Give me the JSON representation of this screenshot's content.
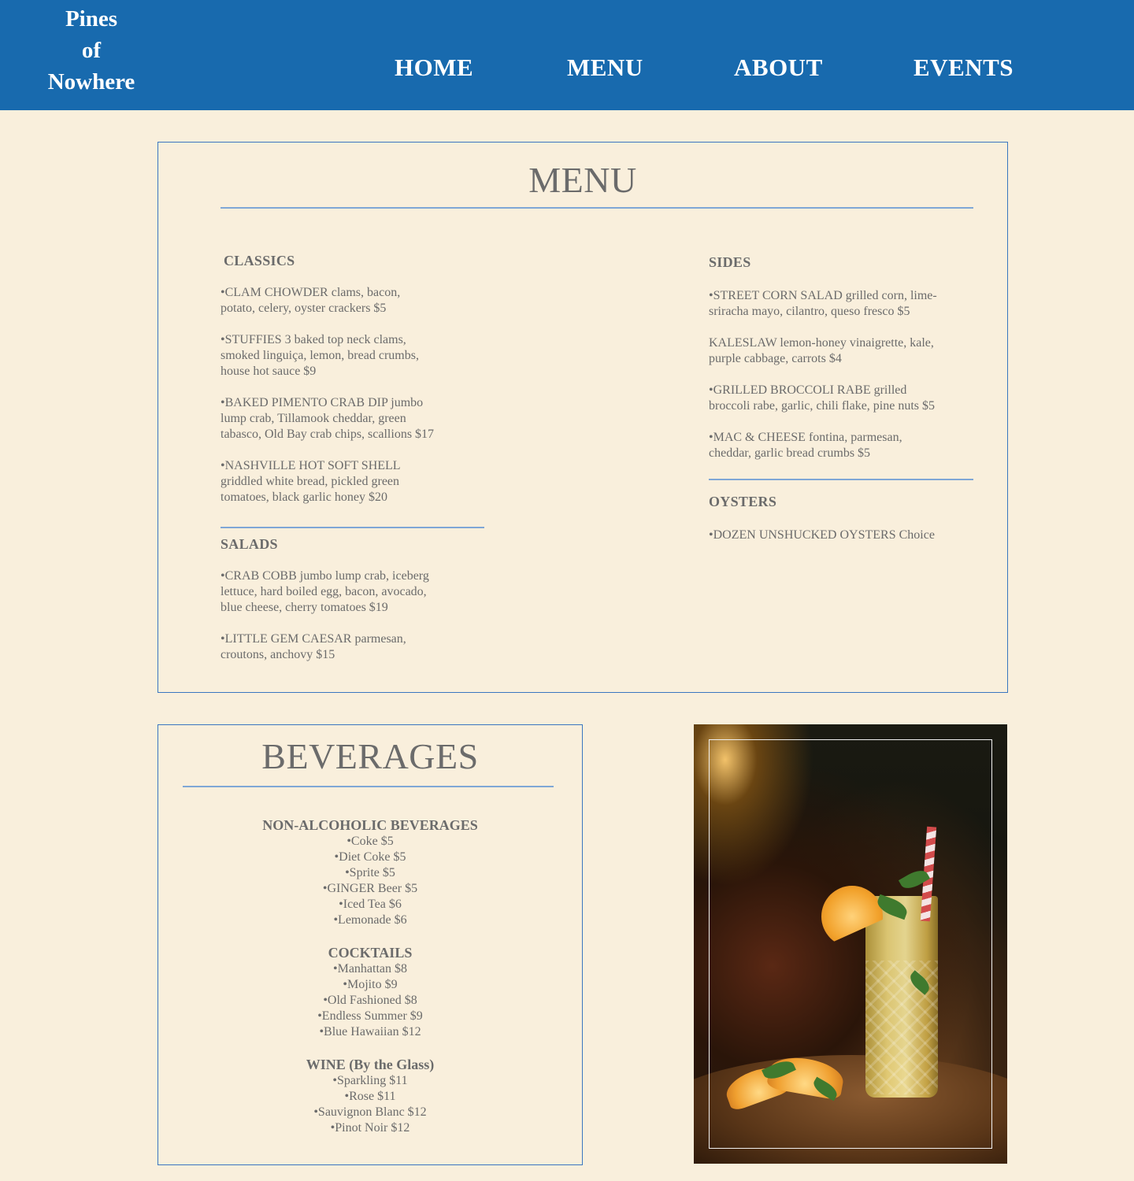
{
  "brand": {
    "lines": [
      "Pines",
      "of",
      "Nowhere"
    ]
  },
  "nav": {
    "items": [
      "HOME",
      "MENU",
      "ABOUT",
      "EVENTS"
    ]
  },
  "menu": {
    "title": "MENU",
    "classics": {
      "heading": "CLASSICS",
      "items": [
        [
          "•CLAM CHOWDER clams, bacon,",
          "potato, celery, oyster crackers $5"
        ],
        [
          "•STUFFIES 3 baked top neck clams,",
          "smoked linguiça, lemon, bread crumbs,",
          "house hot sauce $9"
        ],
        [
          "•BAKED PIMENTO CRAB DIP jumbo",
          "lump crab, Tillamook cheddar, green",
          "tabasco, Old Bay crab chips, scallions $17"
        ],
        [
          "•NASHVILLE HOT SOFT SHELL",
          "griddled white bread, pickled green",
          "tomatoes, black garlic honey $20"
        ]
      ]
    },
    "salads": {
      "heading": "SALADS",
      "items": [
        [
          "•CRAB COBB jumbo lump crab, iceberg",
          "lettuce, hard boiled egg, bacon, avocado,",
          "blue cheese, cherry tomatoes $19"
        ],
        [
          "•LITTLE GEM CAESAR parmesan,",
          "croutons, anchovy $15"
        ]
      ]
    },
    "sides": {
      "heading": "SIDES",
      "items": [
        [
          "•STREET CORN SALAD grilled corn, lime-",
          "sriracha mayo, cilantro, queso fresco $5"
        ],
        [
          "KALESLAW lemon-honey vinaigrette, kale,",
          "purple cabbage, carrots $4"
        ],
        [
          "•GRILLED BROCCOLI RABE grilled",
          "broccoli rabe, garlic, chili flake, pine nuts $5"
        ],
        [
          "•MAC & CHEESE fontina, parmesan,",
          "cheddar, garlic bread crumbs $5"
        ]
      ]
    },
    "oysters": {
      "heading": "OYSTERS",
      "items": [
        [
          "•DOZEN UNSHUCKED OYSTERS Choice"
        ]
      ]
    }
  },
  "beverages": {
    "title": "BEVERAGES",
    "groups": [
      {
        "heading": "NON-ALCOHOLIC BEVERAGES",
        "items": [
          "•Coke $5",
          "•Diet Coke $5",
          "•Sprite $5",
          "•GINGER Beer $5",
          "•Iced Tea $6",
          "•Lemonade $6"
        ]
      },
      {
        "heading": "COCKTAILS",
        "items": [
          "•Manhattan $8",
          "•Mojito $9",
          "•Old Fashioned $8",
          "•Endless Summer $9",
          "•Blue Hawaiian $12"
        ]
      },
      {
        "heading": "WINE (By the Glass)",
        "items": [
          "•Sparkling $11",
          "•Rose $11",
          "•Sauvignon Blanc $12",
          "•Pinot Noir  $12"
        ]
      }
    ]
  },
  "colors": {
    "header": "#186aae",
    "background": "#f9efdc",
    "border": "#3a76c0",
    "text": "#6b6b6b"
  }
}
